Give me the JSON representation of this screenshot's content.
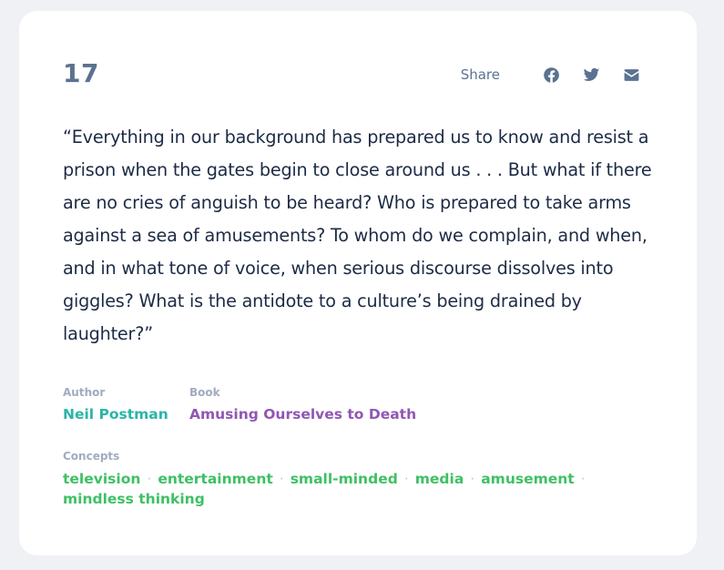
{
  "quote_card": {
    "number": "17",
    "share": {
      "label": "Share",
      "icons": [
        "facebook-icon",
        "twitter-icon",
        "email-icon"
      ]
    },
    "quote_text": "“Everything in our background has prepared us to know and resist a prison when the gates begin to close around us . . . But what if there are no cries of anguish to be heard? Who is prepared to take arms against a sea of amusements? To whom do we complain, and when, and in what tone of voice, when serious discourse dissolves into giggles? What is the antidote to a culture’s being drained by laughter?”",
    "author": {
      "label": "Author",
      "value": "Neil Postman"
    },
    "book": {
      "label": "Book",
      "value": "Amusing Ourselves to Death"
    },
    "concepts": {
      "label": "Concepts",
      "items": [
        "television",
        "entertainment",
        "small-minded",
        "media",
        "amusement",
        "mindless thinking"
      ],
      "separator": "·"
    }
  },
  "colors": {
    "background": "#eff1f5",
    "card": "#ffffff",
    "quote_text": "#1c2b45",
    "muted": "#5b7290",
    "label": "#a1acbe",
    "author": "#2bb5a8",
    "book": "#9157b3",
    "concept": "#3fc065"
  }
}
